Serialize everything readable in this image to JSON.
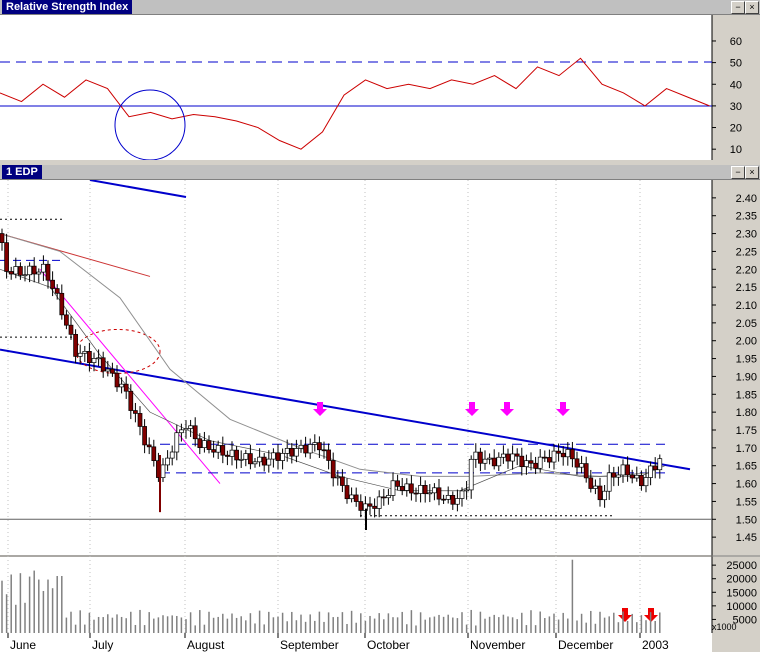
{
  "rsi_panel": {
    "title": "Relative Strength Index"
  },
  "price_panel": {
    "title": "1 EDP"
  },
  "window_buttons": {
    "min": "−",
    "close": "×"
  },
  "volume_unit": "x1000",
  "colors": {
    "up": "#ffffff",
    "down": "#800000",
    "trend": "#0000cc",
    "rsi_line": "#cc0000",
    "magenta": "#ff00ff"
  },
  "chart_data": [
    {
      "type": "line",
      "name": "Relative Strength Index",
      "ylim": [
        5,
        72
      ],
      "yticks": [
        "60",
        "50",
        "40",
        "30",
        "20",
        "10"
      ],
      "reference_lines": [
        50,
        30
      ],
      "x": [
        0,
        5,
        10,
        15,
        20,
        25,
        30,
        35,
        40,
        45,
        50,
        55,
        60,
        65,
        70,
        75,
        80,
        85,
        90,
        95,
        100,
        105,
        110,
        115,
        120,
        125,
        130,
        135,
        140,
        145,
        150,
        155,
        160,
        165
      ],
      "values": [
        36,
        32,
        40,
        34,
        42,
        38,
        25,
        27,
        24,
        26,
        25,
        23,
        20,
        14,
        10,
        18,
        35,
        42,
        38,
        40,
        38,
        42,
        40,
        44,
        38,
        48,
        44,
        52,
        40,
        36,
        30,
        38,
        34,
        30
      ]
    },
    {
      "type": "candlestick",
      "name": "1 EDP",
      "ylim": [
        1.4,
        2.45
      ],
      "yticks": [
        "2.40",
        "2.35",
        "2.30",
        "2.25",
        "2.20",
        "2.15",
        "2.10",
        "2.05",
        "2.00",
        "1.95",
        "1.90",
        "1.85",
        "1.80",
        "1.75",
        "1.70",
        "1.65",
        "1.60",
        "1.55",
        "1.50",
        "1.45"
      ],
      "xticks": [
        "June",
        "July",
        "August",
        "September",
        "October",
        "November",
        "December",
        "2003"
      ],
      "annotations": {
        "up_arrows_magenta": 4,
        "down_arrows_red": 2
      }
    },
    {
      "type": "bar",
      "name": "Volume",
      "yticks": [
        "25000",
        "20000",
        "15000",
        "10000",
        "5000"
      ],
      "unit": "x1000"
    }
  ]
}
